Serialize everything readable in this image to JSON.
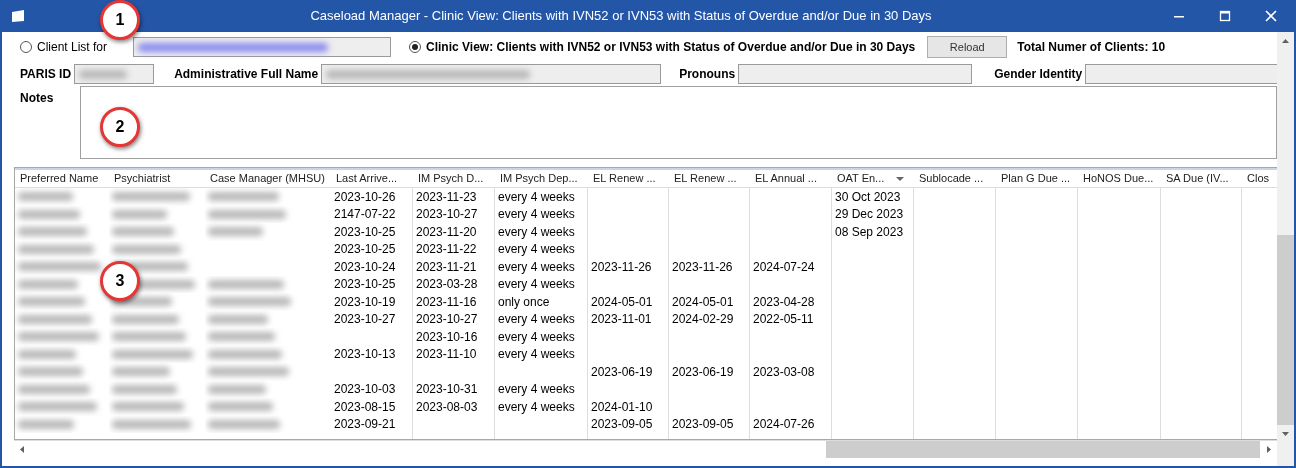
{
  "window": {
    "title": "Caseload Manager - Clinic View: Clients with IVN52 or IVN53 with Status of Overdue and/or Due in 30 Days"
  },
  "view_options": [
    {
      "label": "Client List for",
      "selected": false,
      "field": {
        "redacted": true
      }
    },
    {
      "label": "Clinic View: Clients with IVN52 or IVN53 with Status of Overdue and/or Due in 30 Days",
      "selected": true
    }
  ],
  "reload_button": "Reload",
  "total_clients": "Total Numer of Clients: 10",
  "client_fields": [
    {
      "label": "PARIS ID",
      "redacted": true
    },
    {
      "label": "Administrative Full Name",
      "redacted": true
    },
    {
      "label": "Pronouns",
      "redacted": false
    },
    {
      "label": "Gender Identity",
      "redacted": false
    }
  ],
  "notes": {
    "label": "Notes"
  },
  "table": {
    "columns": [
      {
        "label": "Preferred Name"
      },
      {
        "label": "Psychiatrist"
      },
      {
        "label": "Case Manager (MHSU)"
      },
      {
        "label": "Last Arrive..."
      },
      {
        "label": "IM Psych D..."
      },
      {
        "label": "IM Psych Dep..."
      },
      {
        "label": "EL Renew ..."
      },
      {
        "label": "EL Renew ..."
      },
      {
        "label": "EL Annual ..."
      },
      {
        "label": "OAT En...",
        "sort_descending": true
      },
      {
        "label": "Sublocade ..."
      },
      {
        "label": "Plan G Due ..."
      },
      {
        "label": "HoNOS Due..."
      },
      {
        "label": "SA Due (IV..."
      },
      {
        "label": "Clos"
      }
    ],
    "rows": [
      {
        "blurred": [
          true,
          true,
          true
        ],
        "cells": [
          "",
          "",
          "",
          "2023-10-26",
          "2023-11-23",
          "every 4 weeks",
          "",
          "",
          "",
          "30 Oct 2023",
          "",
          "",
          "",
          "",
          ""
        ]
      },
      {
        "blurred": [
          true,
          true,
          true
        ],
        "cells": [
          "",
          "",
          "",
          "2147-07-22",
          "2023-10-27",
          "every 4 weeks",
          "",
          "",
          "",
          "29 Dec 2023",
          "",
          "",
          "",
          "",
          ""
        ]
      },
      {
        "blurred": [
          true,
          true,
          true
        ],
        "cells": [
          "",
          "",
          "",
          "2023-10-25",
          "2023-11-20",
          "every 4 weeks",
          "",
          "",
          "",
          "08 Sep 2023",
          "",
          "",
          "",
          "",
          ""
        ]
      },
      {
        "blurred": [
          true,
          true,
          false
        ],
        "cells": [
          "",
          "",
          "",
          "2023-10-25",
          "2023-11-22",
          "every 4 weeks",
          "",
          "",
          "",
          "",
          "",
          "",
          "",
          "",
          ""
        ]
      },
      {
        "blurred": [
          true,
          true,
          false
        ],
        "cells": [
          "",
          "",
          "",
          "2023-10-24",
          "2023-11-21",
          "every 4 weeks",
          "2023-11-26",
          "2023-11-26",
          "2024-07-24",
          "",
          "",
          "",
          "",
          "",
          ""
        ]
      },
      {
        "blurred": [
          true,
          true,
          true
        ],
        "cells": [
          "",
          "",
          "",
          "2023-10-25",
          "2023-03-28",
          "every 4 weeks",
          "",
          "",
          "",
          "",
          "",
          "",
          "",
          "",
          ""
        ]
      },
      {
        "blurred": [
          true,
          true,
          true
        ],
        "cells": [
          "",
          "",
          "",
          "2023-10-19",
          "2023-11-16",
          "only once",
          "2024-05-01",
          "2024-05-01",
          "2023-04-28",
          "",
          "",
          "",
          "",
          "",
          ""
        ]
      },
      {
        "blurred": [
          true,
          true,
          true
        ],
        "cells": [
          "",
          "",
          "",
          "2023-10-27",
          "2023-10-27",
          "every 4 weeks",
          "2023-11-01",
          "2024-02-29",
          "2022-05-11",
          "",
          "",
          "",
          "",
          "",
          ""
        ]
      },
      {
        "blurred": [
          true,
          true,
          true
        ],
        "cells": [
          "",
          "",
          "",
          "",
          "2023-10-16",
          "every 4 weeks",
          "",
          "",
          "",
          "",
          "",
          "",
          "",
          "",
          ""
        ]
      },
      {
        "blurred": [
          true,
          true,
          true
        ],
        "cells": [
          "",
          "",
          "",
          "2023-10-13",
          "2023-11-10",
          "every 4 weeks",
          "",
          "",
          "",
          "",
          "",
          "",
          "",
          "",
          ""
        ]
      },
      {
        "blurred": [
          true,
          true,
          true
        ],
        "cells": [
          "",
          "",
          "",
          "",
          "",
          "",
          "2023-06-19",
          "2023-06-19",
          "2023-03-08",
          "",
          "",
          "",
          "",
          "",
          ""
        ]
      },
      {
        "blurred": [
          true,
          true,
          true
        ],
        "cells": [
          "",
          "",
          "",
          "2023-10-03",
          "2023-10-31",
          "every 4 weeks",
          "",
          "",
          "",
          "",
          "",
          "",
          "",
          "",
          ""
        ]
      },
      {
        "blurred": [
          true,
          true,
          true
        ],
        "cells": [
          "",
          "",
          "",
          "2023-08-15",
          "2023-08-03",
          "every 4 weeks",
          "2024-01-10",
          "",
          "",
          "",
          "",
          "",
          "",
          "",
          ""
        ]
      },
      {
        "blurred": [
          true,
          true,
          true
        ],
        "cells": [
          "",
          "",
          "",
          "2023-09-21",
          "",
          "",
          "2023-09-05",
          "2023-09-05",
          "2024-07-26",
          "",
          "",
          "",
          "",
          "",
          ""
        ]
      }
    ]
  },
  "callouts": [
    "1",
    "2",
    "3"
  ]
}
